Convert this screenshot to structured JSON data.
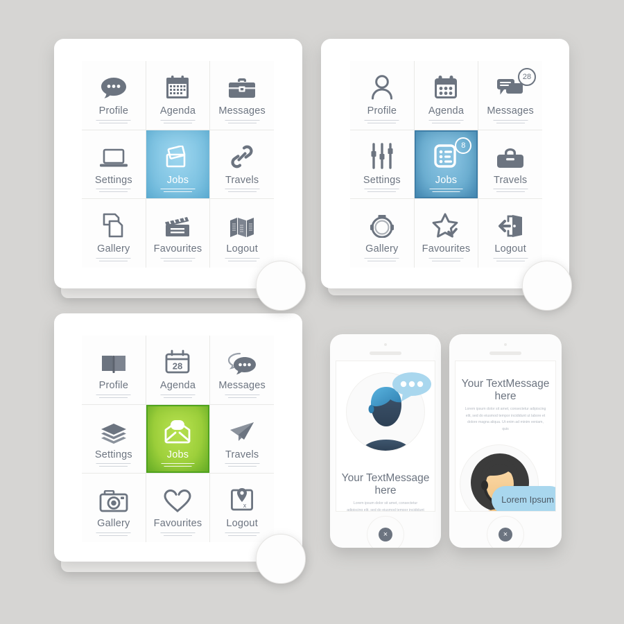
{
  "background_color": "#d6d5d3",
  "palette": {
    "icon_gray": "#6c7480",
    "label_gray": "#6c7480",
    "blue_light": "#7ec3e2",
    "blue_dark": "#6fb1d3",
    "green": "#9fd13c",
    "bubble_blue": "#a9d7ee"
  },
  "sub_text": "Lorem ipsum dolor sit amet, consectetur adipiscing elit, sed do eiusmod tempor",
  "tablets": [
    {
      "id": "tablet-one",
      "accent": "#7ec3e2",
      "cells": [
        {
          "label": "Profile",
          "icon": "speech-bubble-dots-icon",
          "active": false,
          "badge": null
        },
        {
          "label": "Agenda",
          "icon": "calendar-grid-icon",
          "active": false,
          "badge": null
        },
        {
          "label": "Messages",
          "icon": "briefcase-icon",
          "active": false,
          "badge": null
        },
        {
          "label": "Settings",
          "icon": "laptop-icon",
          "active": false,
          "badge": null
        },
        {
          "label": "Jobs",
          "icon": "photo-cards-icon",
          "active": true,
          "badge": null
        },
        {
          "label": "Travels",
          "icon": "chain-link-icon",
          "active": false,
          "badge": null
        },
        {
          "label": "Gallery",
          "icon": "copy-pages-icon",
          "active": false,
          "badge": null
        },
        {
          "label": "Favourites",
          "icon": "clapperboard-icon",
          "active": false,
          "badge": null
        },
        {
          "label": "Logout",
          "icon": "folded-map-icon",
          "active": false,
          "badge": null
        }
      ]
    },
    {
      "id": "tablet-two",
      "accent": "#6fb1d3",
      "cells": [
        {
          "label": "Profile",
          "icon": "person-avatar-icon",
          "active": false,
          "badge": null
        },
        {
          "label": "Agenda",
          "icon": "calendar-dots-icon",
          "active": false,
          "badge": null
        },
        {
          "label": "Messages",
          "icon": "chat-lines-icon",
          "active": false,
          "badge": "28"
        },
        {
          "label": "Settings",
          "icon": "sliders-icon",
          "active": false,
          "badge": null
        },
        {
          "label": "Jobs",
          "icon": "checklist-icon",
          "active": true,
          "badge": "8"
        },
        {
          "label": "Travels",
          "icon": "suitcase-icon",
          "active": false,
          "badge": null
        },
        {
          "label": "Gallery",
          "icon": "camera-outline-icon",
          "active": false,
          "badge": null
        },
        {
          "label": "Favourites",
          "icon": "star-check-icon",
          "active": false,
          "badge": null
        },
        {
          "label": "Logout",
          "icon": "exit-door-icon",
          "active": false,
          "badge": null
        }
      ]
    },
    {
      "id": "tablet-three",
      "accent": "#9fd13c",
      "cells": [
        {
          "label": "Profile",
          "icon": "open-book-icon",
          "active": false,
          "badge": null
        },
        {
          "label": "Agenda",
          "icon": "calendar-28-icon",
          "active": false,
          "badge": "28"
        },
        {
          "label": "Messages",
          "icon": "double-speech-bubble-icon",
          "active": false,
          "badge": null
        },
        {
          "label": "Settings",
          "icon": "layers-stack-icon",
          "active": false,
          "badge": null
        },
        {
          "label": "Jobs",
          "icon": "open-envelope-icon",
          "active": true,
          "badge": null
        },
        {
          "label": "Travels",
          "icon": "paper-plane-icon",
          "active": false,
          "badge": null
        },
        {
          "label": "Gallery",
          "icon": "camera-photo-icon",
          "active": false,
          "badge": null
        },
        {
          "label": "Favourites",
          "icon": "heart-outline-icon",
          "active": false,
          "badge": null
        },
        {
          "label": "Logout",
          "icon": "map-pin-exit-icon",
          "active": false,
          "badge": null
        }
      ]
    }
  ],
  "phones": [
    {
      "id": "phone-one",
      "layout": "avatar-top",
      "avatar": "male-avatar-blue-hair",
      "has_dots_bubble": true,
      "title": "Your TextMessage here",
      "paragraph": "Lorem ipsum dolor sit amet, consectetur adipiscing elit, sed do eiusmod tempor incididunt ut labore et dolore magna aliqua. Ut enim ad minim veniam, quis",
      "close_label": "×"
    },
    {
      "id": "phone-two",
      "layout": "text-top",
      "avatar": "female-avatar-headset",
      "has_dots_bubble": false,
      "title": "Your TextMessage here",
      "paragraph": "Lorem ipsum dolor sit amet, consectetur adipiscing elit, sed do eiusmod tempor incididunt ut labore et dolore magna aliqua. Ut enim ad minim veniam, quis",
      "bubble_text": "Lorem Ipsum",
      "close_label": "×"
    }
  ]
}
